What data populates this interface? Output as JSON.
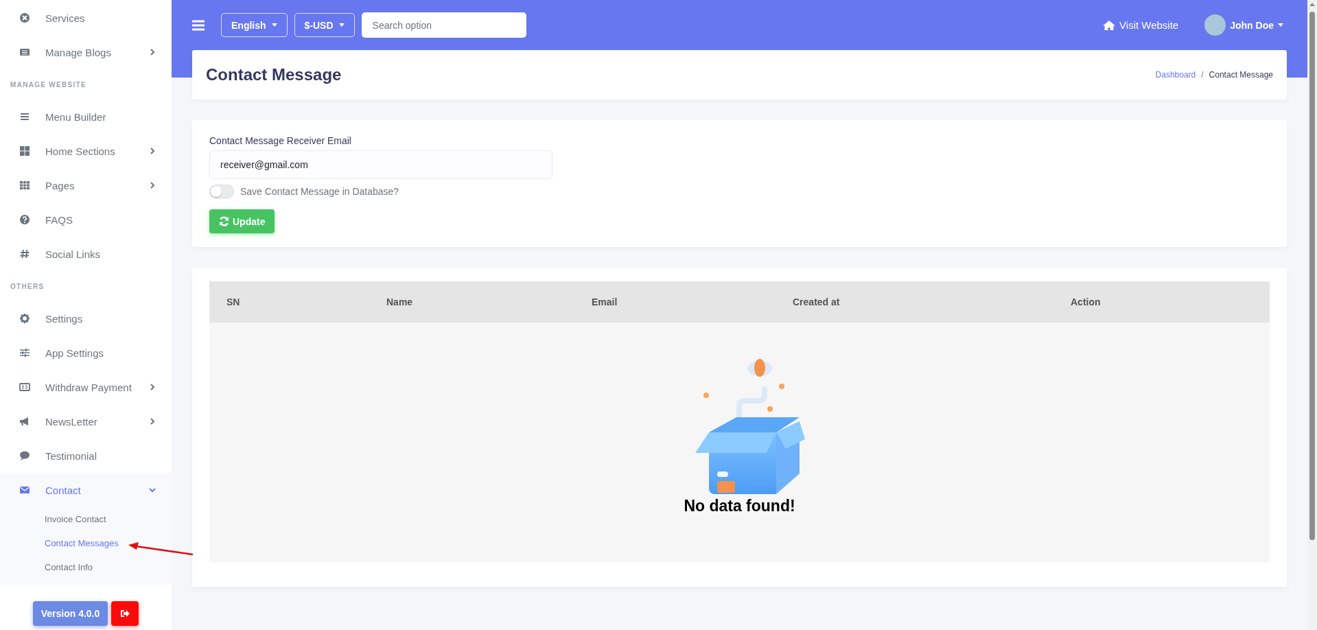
{
  "sidebar": {
    "items": [
      {
        "kind": "link",
        "label": "Services",
        "selected": false
      },
      {
        "kind": "link",
        "label": "Manage Blogs",
        "expanded": false,
        "selected": false
      },
      {
        "kind": "heading",
        "label": "MANAGE WEBSITE"
      },
      {
        "kind": "link",
        "label": "Menu Builder",
        "selected": false
      },
      {
        "kind": "link",
        "label": "Home Sections",
        "expanded": false,
        "selected": false
      },
      {
        "kind": "link",
        "label": "Pages",
        "expanded": false,
        "selected": false
      },
      {
        "kind": "link",
        "label": "FAQS",
        "selected": false
      },
      {
        "kind": "link",
        "label": "Social Links",
        "selected": false
      },
      {
        "kind": "heading",
        "label": "OTHERS"
      },
      {
        "kind": "link",
        "label": "Settings",
        "selected": false
      },
      {
        "kind": "link",
        "label": "App Settings",
        "selected": false
      },
      {
        "kind": "link",
        "label": "Withdraw Payment",
        "expanded": false,
        "selected": false
      },
      {
        "kind": "link",
        "label": "NewsLetter",
        "expanded": false,
        "selected": false
      },
      {
        "kind": "link",
        "label": "Testimonial",
        "selected": false
      },
      {
        "kind": "link",
        "label": "Contact",
        "expanded": true,
        "selected": true,
        "children": [
          {
            "label": "Invoice Contact",
            "selected": false
          },
          {
            "label": "Contact Messages",
            "selected": true
          },
          {
            "label": "Contact Info",
            "selected": false
          }
        ]
      }
    ],
    "version_button": "Version 4.0.0"
  },
  "topbar": {
    "language": "English",
    "currency": "$-USD",
    "search": {
      "placeholder": "Search option"
    },
    "visit_website": "Visit Website",
    "user": "John Doe"
  },
  "page": {
    "title": "Contact Message",
    "breadcrumb_separator": "/",
    "breadcrumb": [
      {
        "label": "Dashboard",
        "link": true
      },
      {
        "label": "Contact Message",
        "link": false
      }
    ]
  },
  "form": {
    "label": "Contact Message Receiver Email",
    "value": "receiver@gmail.com",
    "toggle": {
      "label": "Save Contact Message in Database?",
      "on": false
    },
    "button": "Update"
  },
  "table": {
    "columns": [
      "SN",
      "Name",
      "Email",
      "Created at",
      "Action"
    ],
    "empty_message": "No data found!"
  }
}
